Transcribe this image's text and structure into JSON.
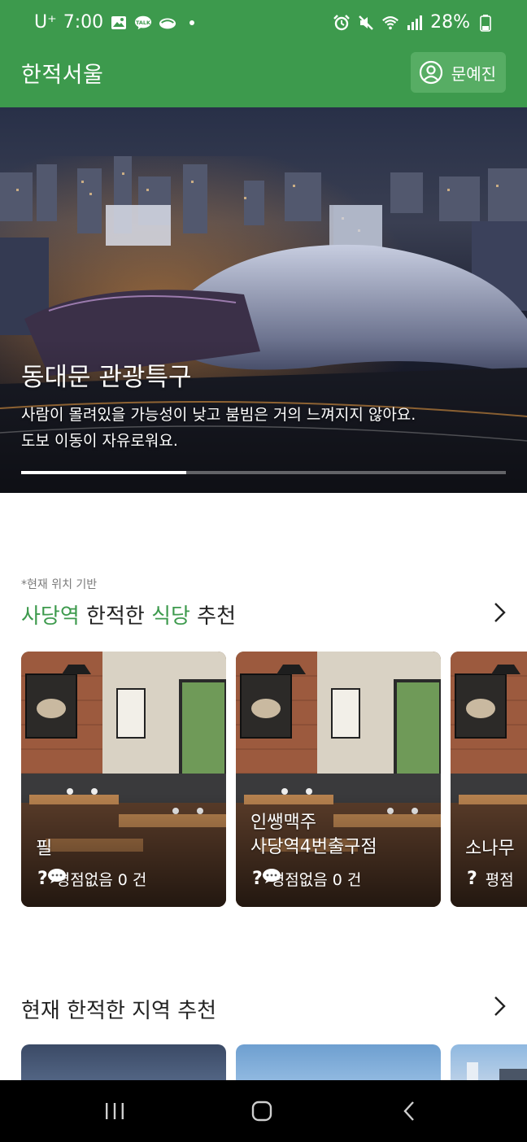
{
  "status_bar": {
    "carrier": "U⁺",
    "time": "7:00",
    "battery": "28%",
    "icons_left": [
      "gallery-icon",
      "kakaotalk-icon",
      "cloud-icon",
      "dot-icon"
    ],
    "icons_right": [
      "alarm-icon",
      "mute-icon",
      "wifi-icon",
      "signal-icon",
      "battery-icon"
    ]
  },
  "app_bar": {
    "title": "한적서울",
    "profile_name": "문예진"
  },
  "hero": {
    "title": "동대문 관광특구",
    "description_line1": "사람이 몰려있을 가능성이 낮고 붐빔은 거의 느껴지지 않아요.",
    "description_line2": "도보 이동이 자유로워요.",
    "progress": 0.34
  },
  "restaurants_section": {
    "note": "*현재 위치 기반",
    "heading_place": "사당역",
    "heading_mid": " 한적한 ",
    "heading_type": "식당",
    "heading_end": " 추천",
    "cards": [
      {
        "name_line1": "필",
        "name_line2": "",
        "rating": "평점없음",
        "review_count": "0 건"
      },
      {
        "name_line1": "인쌩맥주",
        "name_line2": "사당역4번출구점",
        "rating": "평점없음",
        "review_count": "0 건"
      },
      {
        "name_line1": "소나무",
        "name_line2": "",
        "rating": "평점",
        "review_count": ""
      }
    ]
  },
  "areas_section": {
    "heading": "현재 한적한 지역 추천"
  },
  "colors": {
    "brand_green": "#3d9a4d",
    "highlight_green": "#3d9a4d",
    "nav_bar": "#000000"
  }
}
